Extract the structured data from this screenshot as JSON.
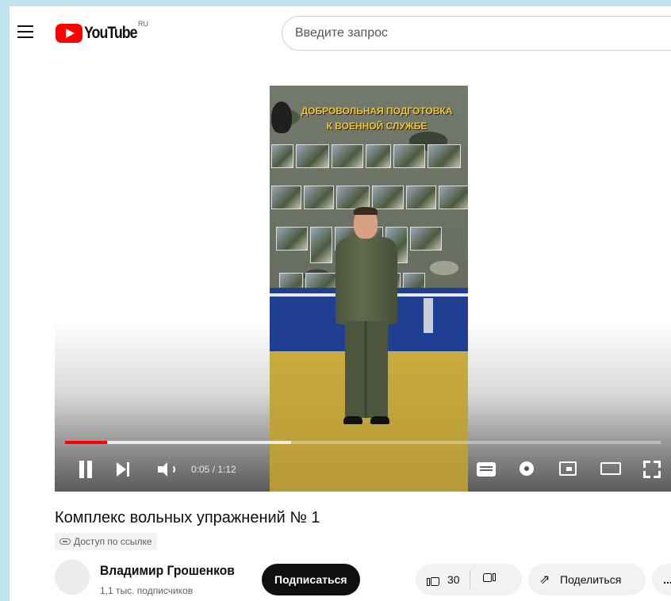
{
  "header": {
    "logo_text": "YouTube",
    "region": "RU",
    "search_placeholder": "Введите запрос"
  },
  "video_content": {
    "banner_line1": "ДОБРОВОЛЬНАЯ ПОДГОТОВКА",
    "banner_line2": "К ВОЕННОЙ СЛУЖБЕ"
  },
  "player": {
    "current_time": "0:05",
    "duration": "1:12",
    "time_display": "0:05 / 1:12",
    "played_fraction": 0.07,
    "buffered_fraction": 0.38
  },
  "video": {
    "title": "Комплекс вольных упражнений № 1",
    "access_label": "Доступ по ссылке"
  },
  "channel": {
    "name": "Владимир Грошенков",
    "subscribers": "1,1 тыс. подписчиков",
    "subscribe_label": "Подписаться"
  },
  "actions": {
    "like_count": "30",
    "share_label": "Поделиться",
    "more_label": "..."
  },
  "icons": [
    "menu-icon",
    "youtube-logo-icon",
    "pause-icon",
    "next-icon",
    "volume-icon",
    "subtitles-icon",
    "settings-gear-icon",
    "miniplayer-icon",
    "theater-mode-icon",
    "fullscreen-icon",
    "link-icon",
    "thumbs-up-icon",
    "thumbs-down-icon",
    "share-icon"
  ],
  "colors": {
    "accent": "#ff0000",
    "background": "#ffffff",
    "frame": "#bfe4ef",
    "subscribe_bg": "#0f0f0f"
  }
}
